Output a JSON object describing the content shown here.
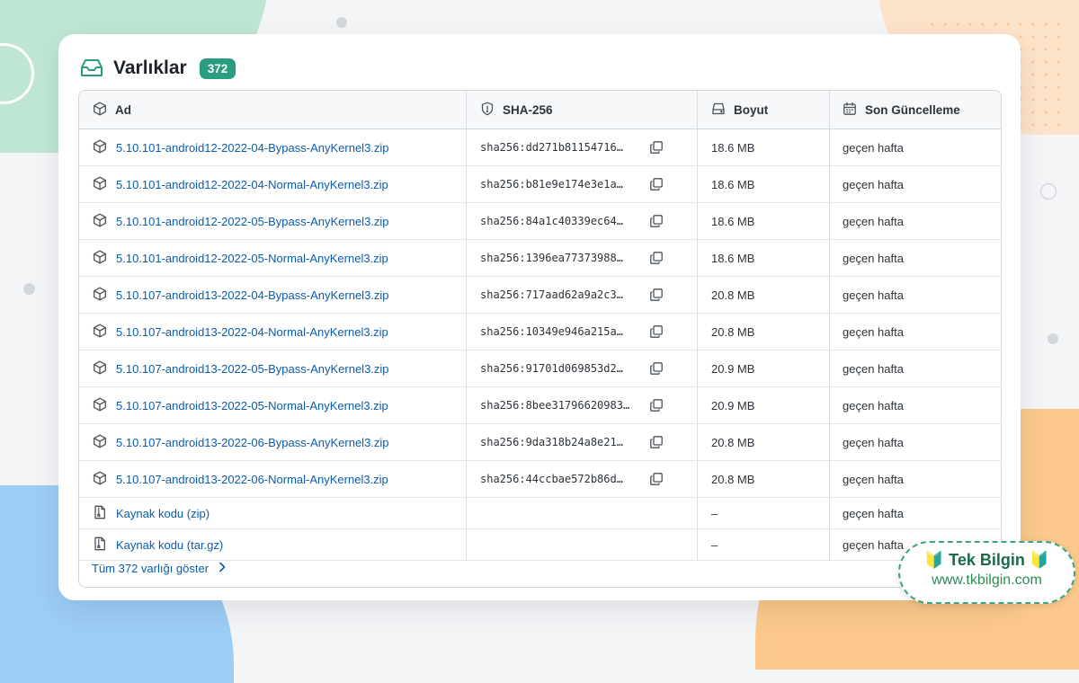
{
  "section": {
    "title": "Varlıklar",
    "count": "372"
  },
  "columns": {
    "name": "Ad",
    "sha": "SHA-256",
    "size": "Boyut",
    "updated": "Son Güncelleme"
  },
  "assets": [
    {
      "name": "5.10.101-android12-2022-04-Bypass-AnyKernel3.zip",
      "sha": "sha256:dd271b81154716…",
      "size": "18.6 MB",
      "updated": "geçen hafta"
    },
    {
      "name": "5.10.101-android12-2022-04-Normal-AnyKernel3.zip",
      "sha": "sha256:b81e9e174e3e1a…",
      "size": "18.6 MB",
      "updated": "geçen hafta"
    },
    {
      "name": "5.10.101-android12-2022-05-Bypass-AnyKernel3.zip",
      "sha": "sha256:84a1c40339ec64…",
      "size": "18.6 MB",
      "updated": "geçen hafta"
    },
    {
      "name": "5.10.101-android12-2022-05-Normal-AnyKernel3.zip",
      "sha": "sha256:1396ea77373988…",
      "size": "18.6 MB",
      "updated": "geçen hafta"
    },
    {
      "name": "5.10.107-android13-2022-04-Bypass-AnyKernel3.zip",
      "sha": "sha256:717aad62a9a2c3…",
      "size": "20.8 MB",
      "updated": "geçen hafta"
    },
    {
      "name": "5.10.107-android13-2022-04-Normal-AnyKernel3.zip",
      "sha": "sha256:10349e946a215a…",
      "size": "20.8 MB",
      "updated": "geçen hafta"
    },
    {
      "name": "5.10.107-android13-2022-05-Bypass-AnyKernel3.zip",
      "sha": "sha256:91701d069853d2…",
      "size": "20.9 MB",
      "updated": "geçen hafta"
    },
    {
      "name": "5.10.107-android13-2022-05-Normal-AnyKernel3.zip",
      "sha": "sha256:8bee31796620983…",
      "size": "20.9 MB",
      "updated": "geçen hafta"
    },
    {
      "name": "5.10.107-android13-2022-06-Bypass-AnyKernel3.zip",
      "sha": "sha256:9da318b24a8e21…",
      "size": "20.8 MB",
      "updated": "geçen hafta"
    },
    {
      "name": "5.10.107-android13-2022-06-Normal-AnyKernel3.zip",
      "sha": "sha256:44ccbae572b86d…",
      "size": "20.8 MB",
      "updated": "geçen hafta"
    }
  ],
  "sources": [
    {
      "name": "Kaynak kodu (zip)",
      "size": "–",
      "updated": "geçen hafta"
    },
    {
      "name": "Kaynak kodu (tar.gz)",
      "size": "–",
      "updated": "geçen hafta"
    }
  ],
  "footer": {
    "show_all": "Tüm 372 varlığı göster"
  },
  "watermark": {
    "name": "Tek Bilgin",
    "url": "www.tkbilgin.com"
  },
  "colors": {
    "accent": "#2a9d80",
    "link": "#0b5cad"
  }
}
